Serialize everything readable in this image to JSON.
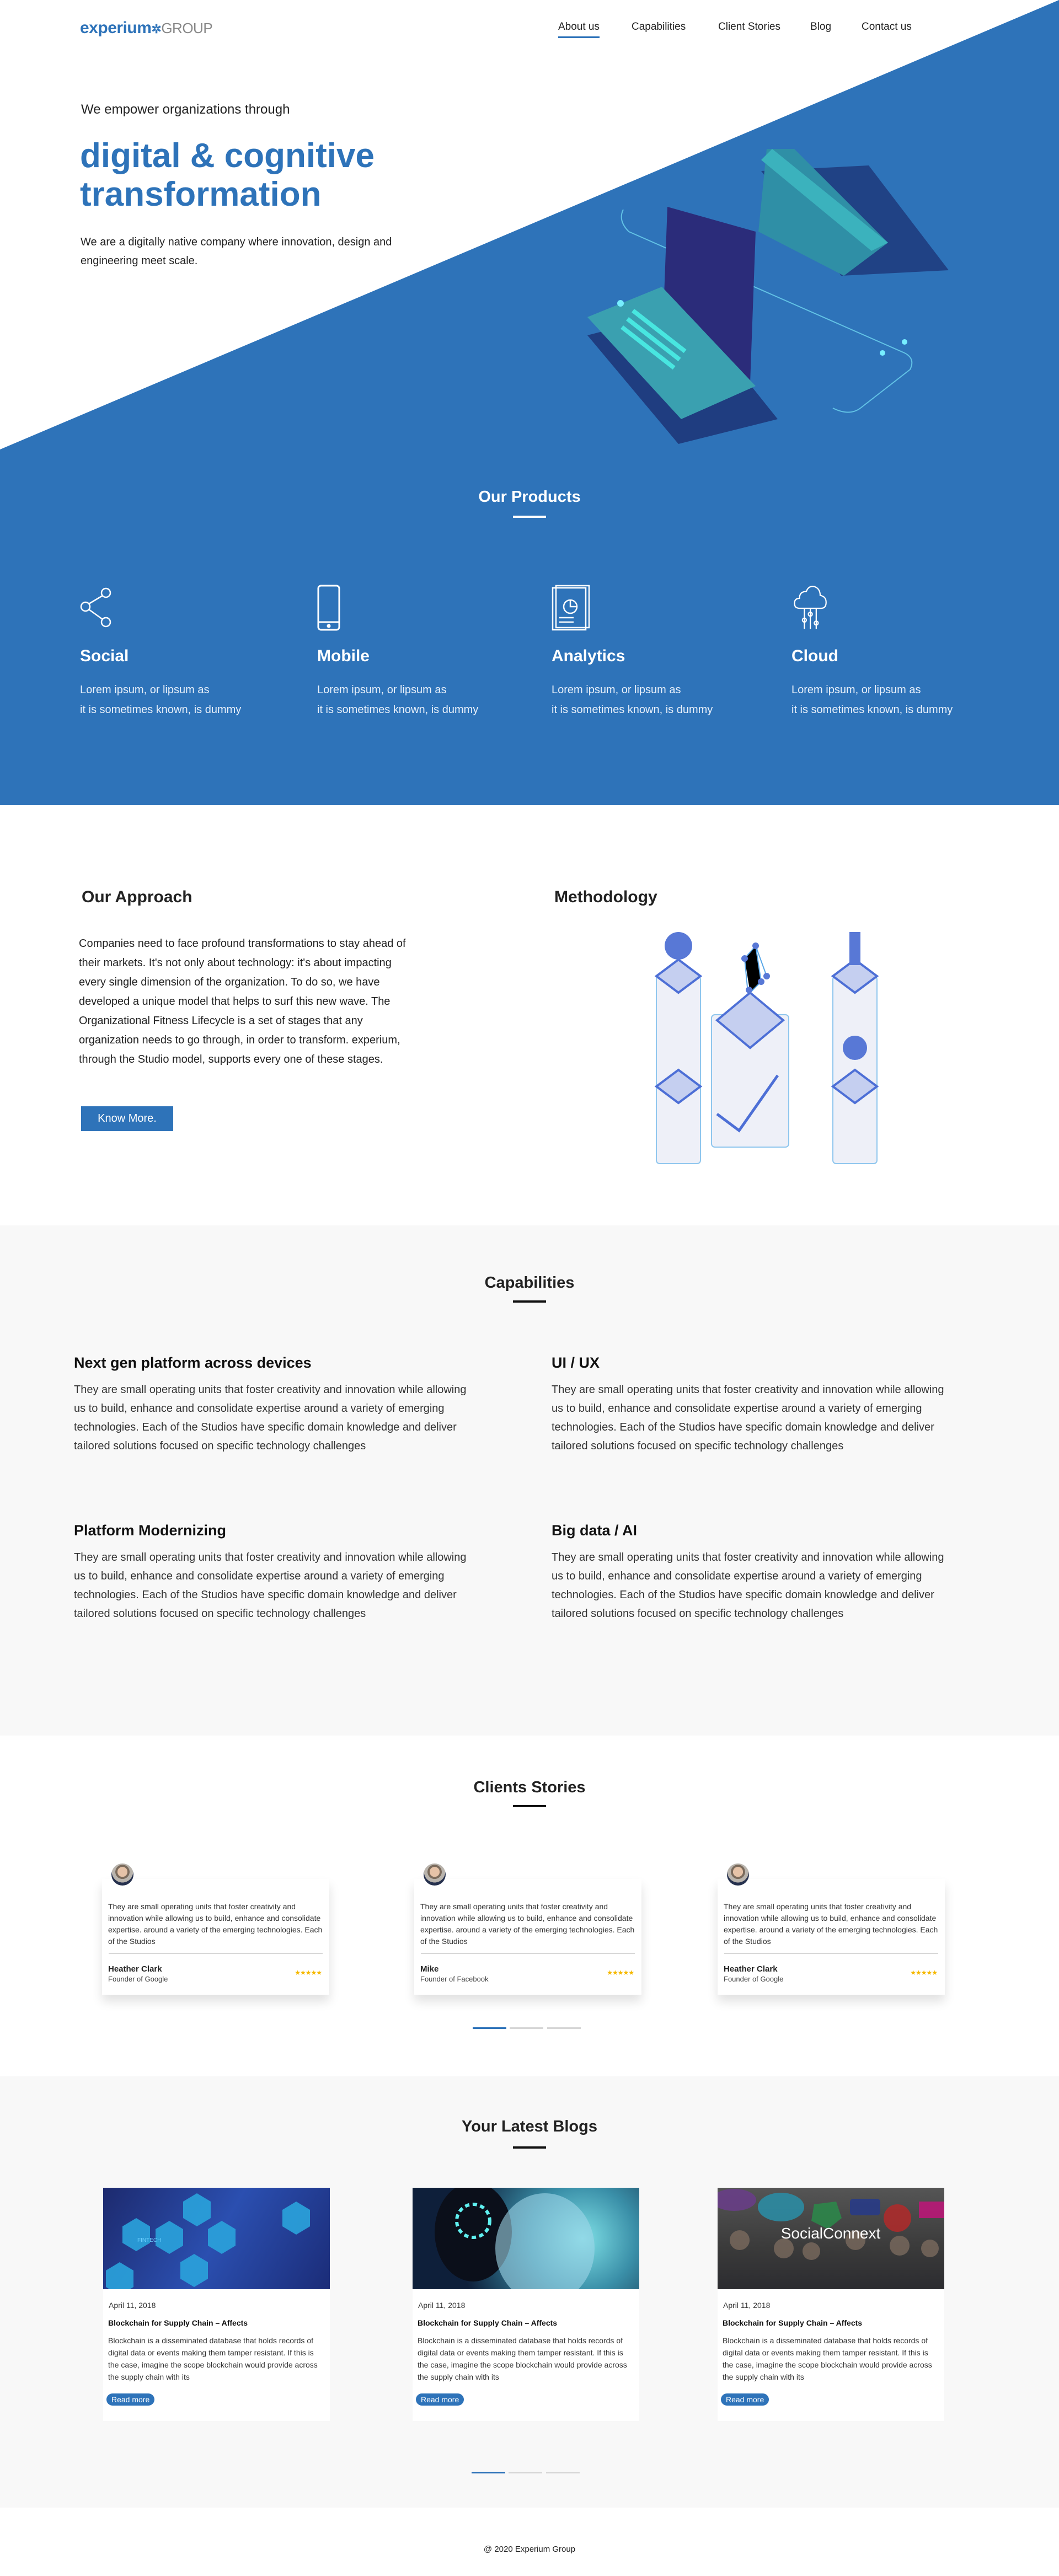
{
  "colors": {
    "brand": "#2e73b9",
    "section_gray": "#f8f8f8",
    "star": "#f5b800"
  },
  "header": {
    "logo_main": "experium",
    "logo_sub": "GROUP",
    "nav": [
      {
        "label": "About us",
        "active": true
      },
      {
        "label": "Capabilities"
      },
      {
        "label": "Client Stories"
      },
      {
        "label": "Blog"
      },
      {
        "label": "Contact us"
      }
    ]
  },
  "hero": {
    "kicker": "We empower organizations through",
    "headline_1": "digital & cognitive",
    "headline_2": "transformation",
    "description": "We are a digitally native company where innovation, design and engineering meet scale."
  },
  "products": {
    "title": "Our Products",
    "items": [
      {
        "icon": "share-icon",
        "title": "Social",
        "line1": "Lorem ipsum, or lipsum as",
        "line2": "it is sometimes known, is dummy"
      },
      {
        "icon": "mobile-icon",
        "title": "Mobile",
        "line1": "Lorem ipsum, or lipsum as",
        "line2": "it is sometimes known, is dummy"
      },
      {
        "icon": "analytics-icon",
        "title": "Analytics",
        "line1": "Lorem ipsum, or lipsum as",
        "line2": "it is sometimes known, is dummy"
      },
      {
        "icon": "cloud-icon",
        "title": "Cloud",
        "line1": "Lorem ipsum, or lipsum as",
        "line2": "it is sometimes known, is dummy"
      }
    ]
  },
  "approach": {
    "title": "Our Approach",
    "body": "Companies need to face profound transformations to stay ahead of their markets. It's not only about technology: it's about impacting every single dimension of the organization. To do so, we have developed a unique model that helps to surf this new wave. The Organizational Fitness Lifecycle is a set of stages that any organization needs to go through, in order to transform. experium, through the Studio model, supports every one of these stages.",
    "button": "Know More.",
    "methodology_title": "Methodology"
  },
  "capabilities": {
    "title": "Capabilities",
    "items": [
      {
        "title": "Next gen platform across devices",
        "body": "They are small operating units that foster creativity and innovation while allowing us to build, enhance and consolidate expertise around a variety of emerging technologies. Each of the Studios have specific domain knowledge and deliver tailored solutions focused on specific technology challenges"
      },
      {
        "title": "UI / UX",
        "body": "They are small operating units that foster creativity and innovation while allowing us to build, enhance and consolidate expertise around a variety of emerging technologies. Each of the Studios have specific domain knowledge and deliver tailored solutions focused on specific technology challenges"
      },
      {
        "title": "Platform Modernizing",
        "body": "They are small operating units that foster creativity and innovation while allowing us to build, enhance and consolidate expertise around a variety of emerging technologies. Each of the Studios have specific domain knowledge and deliver tailored solutions focused on specific technology challenges"
      },
      {
        "title": "Big data / AI",
        "body": "They are small operating units that foster creativity and innovation while allowing us to build, enhance and consolidate expertise around a variety of emerging technologies. Each of the Studios have specific domain knowledge and deliver tailored solutions focused on specific technology challenges"
      }
    ]
  },
  "clients": {
    "title": "Clients Stories",
    "active_slide": 1,
    "slides": 3,
    "items": [
      {
        "text": "They are small operating units that foster creativity and innovation while allowing us to build, enhance and consolidate expertise. around a variety of the emerging technologies. Each of the Studios",
        "name": "Heather Clark",
        "role": "Founder of Google",
        "rating": 5,
        "stars": "★★★★★"
      },
      {
        "text": "They are small operating units that foster creativity and innovation while allowing us to build, enhance and consolidate expertise. around a variety of the emerging technologies. Each of the Studios",
        "name": "Mike",
        "role": "Founder of Facebook",
        "rating": 5,
        "stars": "★★★★★"
      },
      {
        "text": "They are small operating units that foster creativity and innovation while allowing us to build, enhance and consolidate expertise. around a variety of the emerging technologies. Each of the Studios",
        "name": "Heather Clark",
        "role": "Founder of Google",
        "rating": 5,
        "stars": "★★★★★"
      }
    ]
  },
  "blogs": {
    "title": "Your Latest Blogs",
    "active_slide": 1,
    "slides": 3,
    "items": [
      {
        "image": "fintech-hexagons",
        "image_label": "FINTECH",
        "date": "April 11, 2018",
        "title": "Blockchain for Supply Chain – Affects",
        "body": "Blockchain is a disseminated database that holds records of digital data or events making them tamper resistant. If this is the case, imagine the scope blockchain would provide across the supply chain with its",
        "button": "Read more"
      },
      {
        "image": "robot-head",
        "date": "April 11, 2018",
        "title": "Blockchain for Supply Chain – Affects",
        "body": "Blockchain is a disseminated database that holds records of digital data or events making them tamper resistant. If this is the case, imagine the scope blockchain would provide across the supply chain with its",
        "button": "Read more"
      },
      {
        "image": "socialconnext-people",
        "image_label": "SocialConnext",
        "date": "April 11, 2018",
        "title": "Blockchain for Supply Chain – Affects",
        "body": "Blockchain is a disseminated database that holds records of digital data or events making them tamper resistant. If this is the case, imagine the scope blockchain would provide across the supply chain with its",
        "button": "Read more"
      }
    ]
  },
  "footer": {
    "copyright": "@ 2020 Experium Group"
  }
}
